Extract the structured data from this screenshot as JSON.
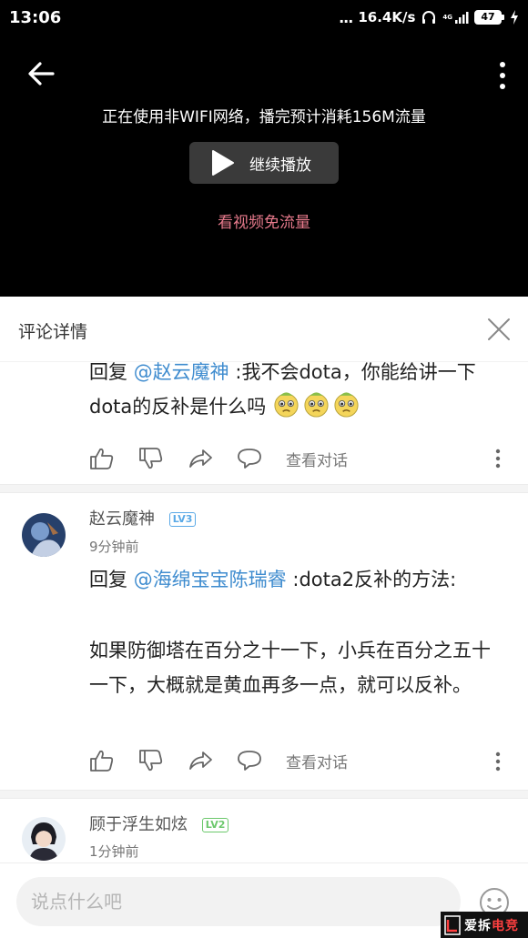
{
  "status_bar": {
    "time": "13:06",
    "dots": "...",
    "net_speed": "16.4K/s",
    "network_type": "4G",
    "battery": "47"
  },
  "video": {
    "network_warning": "正在使用非WIFI网络，播完预计消耗156M流量",
    "continue_label": "继续播放",
    "free_data_link": "看视频免流量"
  },
  "comment_panel": {
    "title": "评论详情"
  },
  "comments": [
    {
      "reply_prefix": "回复",
      "mention": "@赵云魔神",
      "text": ":我不会dota，你能给讲一下dota的反补是什么吗",
      "emoji": "pleading-face",
      "view_conversation": "查看对话"
    },
    {
      "user": "赵云魔神",
      "level": "LV3",
      "time_ago": "9分钟前",
      "reply_prefix": "回复",
      "mention": "@海绵宝宝陈瑞睿",
      "text": ":dota2反补的方法:",
      "body": "如果防御塔在百分之十一下，小兵在百分之五十一下，大概就是黄血再多一点，就可以反补。",
      "view_conversation": "查看对话"
    },
    {
      "user": "顾于浮生如炫",
      "level": "LV2",
      "time_ago": "1分钟前"
    }
  ],
  "bottom_bar": {
    "input_placeholder": "说点什么吧"
  },
  "watermark": {
    "text_white": "爱拆",
    "text_red": "电竞"
  },
  "colors": {
    "mention": "#3f8ccf",
    "free_data_link": "#e77a8c",
    "lv3_badge": "#5aa9e6",
    "lv2_badge": "#6cc86c"
  }
}
